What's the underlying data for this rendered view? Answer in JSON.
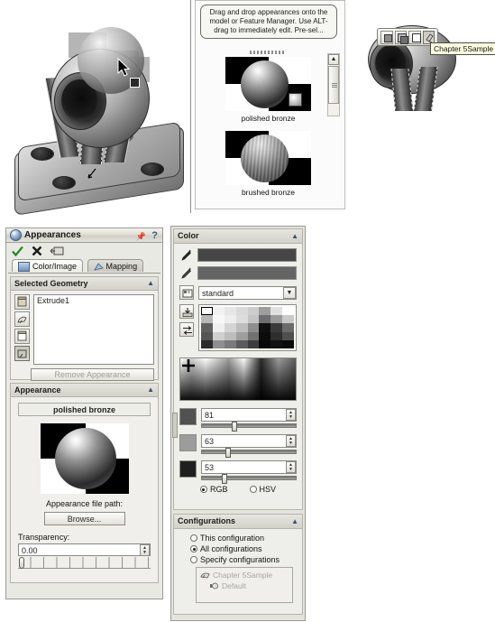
{
  "appearance_browser": {
    "hint_text": "Drag and drop appearances onto the model or Feature Manager.  Use ALT-drag to immediately edit.  Pre-sel...",
    "items": [
      {
        "label": "polished bronze",
        "type": "polished"
      },
      {
        "label": "brushed bronze",
        "type": "brushed"
      }
    ]
  },
  "viewport_toolbar": {
    "tooltip": "Chapter 5Sample",
    "buttons": [
      {
        "name": "shaded",
        "label": ""
      },
      {
        "name": "shaded-with-edges",
        "label": ""
      },
      {
        "name": "hidden-lines-removed",
        "label": ""
      },
      {
        "name": "apply-appearance",
        "label": ""
      }
    ]
  },
  "appearances_panel": {
    "title": "Appearances",
    "help_icon": "?",
    "pin_icon": "pin",
    "toolbar": {
      "ok_label": "OK",
      "cancel_label": "Cancel",
      "keep_visible_label": "Keep Visible"
    },
    "tabs": [
      {
        "label": "Color/Image",
        "active": true,
        "icon": "image-icon"
      },
      {
        "label": "Mapping",
        "active": false,
        "icon": "mapping-icon"
      }
    ],
    "selected_geometry": {
      "header": "Selected Geometry",
      "filters": [
        {
          "name": "select-faces",
          "active": false
        },
        {
          "name": "select-bodies",
          "active": false
        },
        {
          "name": "select-features",
          "active": false
        },
        {
          "name": "select-part",
          "active": true
        }
      ],
      "items": [
        "Extrude1"
      ],
      "remove_button": "Remove Appearance"
    },
    "appearance": {
      "header": "Appearance",
      "name": "polished bronze",
      "file_path_label": "Appearance file path:",
      "browse_button": "Browse...",
      "transparency_label": "Transparency:",
      "transparency_value": "0.00",
      "transparency_percent": 0
    }
  },
  "color_panel": {
    "header": "Color",
    "primary_swatch": "#464646",
    "secondary_swatch": "#646464",
    "eyedropper_primary": "eyedropper-icon",
    "eyedropper_secondary": "eyedropper-icon",
    "palette_select": {
      "value": "standard",
      "options": [
        "standard"
      ]
    },
    "side_buttons": [
      {
        "name": "color-palette-icon"
      },
      {
        "name": "save-swatch-icon"
      },
      {
        "name": "swap-colors-icon"
      }
    ],
    "swatches": [
      "#ffffff",
      "#f2f2f2",
      "#e6e6e6",
      "#d9d9d9",
      "#cccccc",
      "#9e9e9e",
      "#e0e0e0",
      "#ffffff",
      "#b8b8b8",
      "#f7f7f7",
      "#ededed",
      "#dcdcdc",
      "#c4c4c4",
      "#6e6e6e",
      "#9a9a9a",
      "#c9c9c9",
      "#606060",
      "#efefef",
      "#d4d4d4",
      "#bdbdbd",
      "#8d8d8d",
      "#101010",
      "#3a3a3a",
      "#6b6b6b",
      "#555555",
      "#cfcfcf",
      "#bdbdbd",
      "#9e9e9e",
      "#717171",
      "#0c0c0c",
      "#2e2e2e",
      "#4f4f4f",
      "#2b2b2b",
      "#8f8f8f",
      "#7a7a7a",
      "#5c5c5c",
      "#3d3d3d",
      "#070707",
      "#111111",
      "#0a0a0a"
    ],
    "selected_swatch_index": 0,
    "channels": [
      {
        "name": "R",
        "value": "81",
        "percent": 32,
        "swatch": "#515151"
      },
      {
        "name": "G",
        "value": "63",
        "percent": 25,
        "swatch": "#9c9c9c"
      },
      {
        "name": "B",
        "value": "53",
        "percent": 21,
        "swatch": "#1f1f1f"
      }
    ],
    "mode": {
      "rgb_label": "RGB",
      "hsv_label": "HSV",
      "selected": "RGB"
    }
  },
  "configurations_panel": {
    "header": "Configurations",
    "options": [
      {
        "label": "This configuration",
        "selected": false
      },
      {
        "label": "All configurations",
        "selected": true
      },
      {
        "label": "Specify configurations",
        "selected": false
      }
    ],
    "tree": [
      {
        "label": "Chapter 5Sample",
        "icon": "part-icon",
        "disabled": true
      },
      {
        "label": "Default",
        "icon": "config-icon",
        "disabled": true
      }
    ]
  }
}
